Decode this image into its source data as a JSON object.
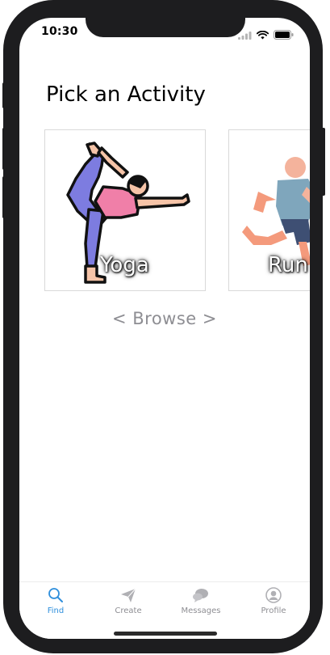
{
  "status_bar": {
    "time": "10:30",
    "icons": [
      "signal-icon",
      "wifi-icon",
      "battery-icon"
    ]
  },
  "page": {
    "title": "Pick an Activity"
  },
  "activities": [
    {
      "label": "Yoga",
      "icon": "yoga-pose-icon"
    },
    {
      "label": "Run",
      "icon": "runner-icon"
    }
  ],
  "browse_label": "< Browse >",
  "tab_bar": {
    "active": "Find",
    "active_color": "#2f8fdc",
    "inactive_color": "#8e8e93",
    "items": [
      {
        "label": "Find",
        "icon": "search-icon"
      },
      {
        "label": "Create",
        "icon": "paper-plane-icon"
      },
      {
        "label": "Messages",
        "icon": "chat-bubble-icon"
      },
      {
        "label": "Profile",
        "icon": "user-icon"
      }
    ]
  }
}
